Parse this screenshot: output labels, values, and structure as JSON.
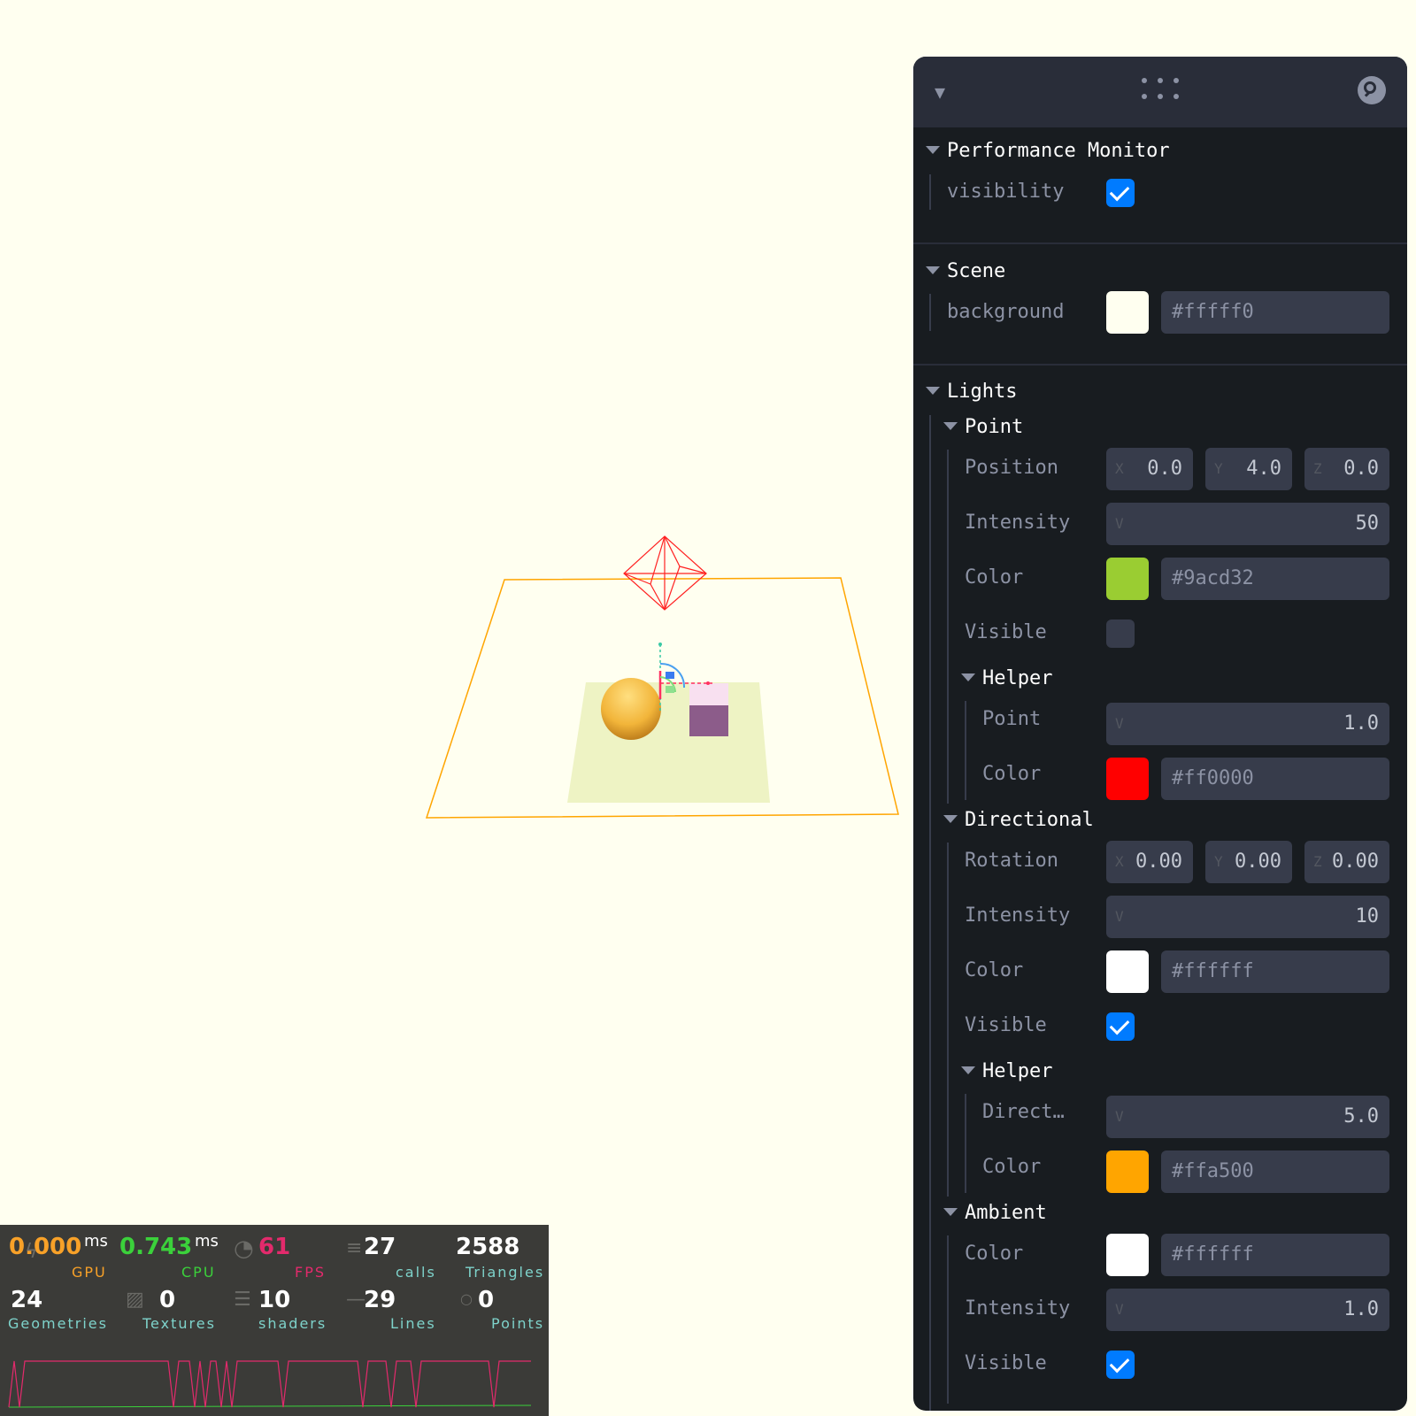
{
  "perf": {
    "gpu_value": "0.000",
    "gpu_unit": "ms",
    "gpu_label": "GPU",
    "cpu_value": "0.743",
    "cpu_unit": "ms",
    "cpu_label": "CPU",
    "fps_value": "61",
    "fps_label": "FPS",
    "calls_value": "27",
    "calls_label": "calls",
    "triangles_value": "2588",
    "triangles_label": "Triangles",
    "geometries_value": "24",
    "geometries_label": "Geometries",
    "textures_value": "0",
    "textures_label": "Textures",
    "shaders_value": "10",
    "shaders_label": "shaders",
    "lines_value": "29",
    "lines_label": "Lines",
    "points_value": "0",
    "points_label": "Points",
    "colors": {
      "gpu": "#f8a128",
      "cpu": "#3bd13b",
      "fps": "#e32a6c",
      "stat": "#ffffff",
      "label": "#7ed3cb"
    }
  },
  "panel": {
    "performance_monitor": {
      "title": "Performance Monitor",
      "visibility_label": "visibility",
      "visibility": true
    },
    "scene": {
      "title": "Scene",
      "background_label": "background",
      "background": "#fffff0"
    },
    "lights": {
      "title": "Lights",
      "point": {
        "title": "Point",
        "position_label": "Position",
        "position": {
          "x": "0.0",
          "y": "4.0",
          "z": "0.0"
        },
        "intensity_label": "Intensity",
        "intensity": "50",
        "color_label": "Color",
        "color": "#9acd32",
        "visible_label": "Visible",
        "visible": false,
        "helper": {
          "title": "Helper",
          "point_label": "Point",
          "point": "1.0",
          "color_label": "Color",
          "color": "#ff0000"
        }
      },
      "directional": {
        "title": "Directional",
        "rotation_label": "Rotation",
        "rotation": {
          "x": "0.00",
          "y": "0.00",
          "z": "0.00"
        },
        "intensity_label": "Intensity",
        "intensity": "10",
        "color_label": "Color",
        "color": "#ffffff",
        "visible_label": "Visible",
        "visible": true,
        "helper": {
          "title": "Helper",
          "direct_label": "Direct…",
          "direct": "5.0",
          "color_label": "Color",
          "color": "#ffa500"
        }
      },
      "ambient": {
        "title": "Ambient",
        "color_label": "Color",
        "color": "#ffffff",
        "intensity_label": "Intensity",
        "intensity": "1.0",
        "visible_label": "Visible",
        "visible": true
      }
    },
    "axis": {
      "x": "X",
      "y": "Y",
      "z": "Z",
      "v": "V"
    }
  }
}
